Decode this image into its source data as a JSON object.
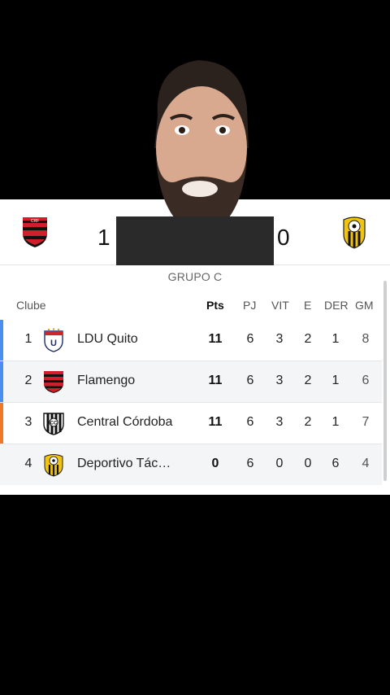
{
  "match": {
    "home_score": "1",
    "away_score": "0"
  },
  "table": {
    "group_label": "GRUPO C",
    "headers": {
      "club": "Clube",
      "pts": "Pts",
      "pj": "PJ",
      "vit": "VIT",
      "e": "E",
      "der": "DER",
      "gm": "GM"
    },
    "rows": [
      {
        "pos": "1",
        "team": "LDU Quito",
        "pts": "11",
        "pj": "6",
        "vit": "3",
        "e": "2",
        "der": "1",
        "gm": "8",
        "crest": "ldu-crest-icon"
      },
      {
        "pos": "2",
        "team": "Flamengo",
        "pts": "11",
        "pj": "6",
        "vit": "3",
        "e": "2",
        "der": "1",
        "gm": "6",
        "crest": "flamengo-crest-icon"
      },
      {
        "pos": "3",
        "team": "Central Córdoba",
        "pts": "11",
        "pj": "6",
        "vit": "3",
        "e": "2",
        "der": "1",
        "gm": "7",
        "crest": "central-cordoba-crest-icon"
      },
      {
        "pos": "4",
        "team": "Deportivo Tác…",
        "pts": "0",
        "pj": "6",
        "vit": "0",
        "e": "0",
        "der": "6",
        "gm": "4",
        "crest": "deportivo-tachira-crest-icon"
      }
    ]
  },
  "colors": {
    "qualify_bar": "#4a8ef0",
    "sudamericana_bar": "#f0782a",
    "flamengo_red": "#d01f2a",
    "tachira_yellow": "#f1c40f"
  }
}
